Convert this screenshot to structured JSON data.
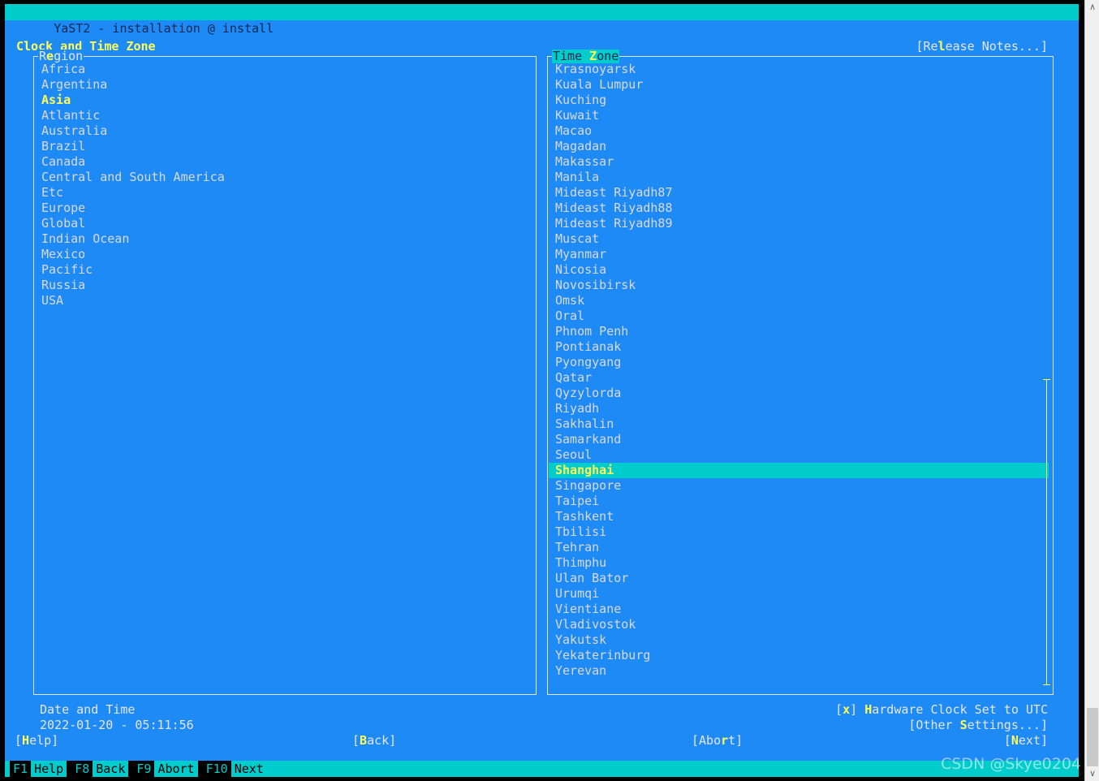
{
  "window": {
    "title": "YaST2 - installation @ install"
  },
  "header": {
    "dialog_title": "Clock and Time Zone",
    "release_notes": "[Release Notes...]",
    "release_notes_pre": "[Re",
    "release_notes_accel": "l",
    "release_notes_post": "ease Notes...]"
  },
  "region_panel": {
    "label_pre": "R",
    "label_accel": "e",
    "label_post": "gion",
    "label": "Region",
    "items": [
      "Africa",
      "Argentina",
      "Asia",
      "Atlantic",
      "Australia",
      "Brazil",
      "Canada",
      "Central and South America",
      "Etc",
      "Europe",
      "Global",
      "Indian Ocean",
      "Mexico",
      "Pacific",
      "Russia",
      "USA"
    ],
    "selected": "Asia"
  },
  "timezone_panel": {
    "label_pre": "Time ",
    "label_accel": "Z",
    "label_post": "one",
    "label": "Time Zone",
    "items": [
      "Krasnoyarsk",
      "Kuala Lumpur",
      "Kuching",
      "Kuwait",
      "Macao",
      "Magadan",
      "Makassar",
      "Manila",
      "Mideast Riyadh87",
      "Mideast Riyadh88",
      "Mideast Riyadh89",
      "Muscat",
      "Myanmar",
      "Nicosia",
      "Novosibirsk",
      "Omsk",
      "Oral",
      "Phnom Penh",
      "Pontianak",
      "Pyongyang",
      "Qatar",
      "Qyzylorda",
      "Riyadh",
      "Sakhalin",
      "Samarkand",
      "Seoul",
      "Shanghai",
      "Singapore",
      "Taipei",
      "Tashkent",
      "Tbilisi",
      "Tehran",
      "Thimphu",
      "Ulan Bator",
      "Urumqi",
      "Vientiane",
      "Vladivostok",
      "Yakutsk",
      "Yekaterinburg",
      "Yerevan"
    ],
    "selected": "Shanghai"
  },
  "datetime": {
    "label": "Date and Time",
    "value": "2022-01-20 - 05:11:56"
  },
  "hardware_clock": {
    "bracket_open": "[",
    "checked_mark": "x",
    "bracket_close": "] ",
    "accel": "H",
    "text": "ardware Clock Set to UTC",
    "full": "[x] Hardware Clock Set to UTC"
  },
  "other_settings": {
    "pre": "[Other ",
    "accel": "S",
    "post": "ettings...]",
    "full": "[Other Settings...]"
  },
  "buttons": {
    "help": {
      "pre": "[",
      "accel": "H",
      "post": "elp]",
      "full": "[Help]"
    },
    "back": {
      "pre": "[",
      "accel": "B",
      "post": "ack]",
      "full": "[Back]"
    },
    "abort": {
      "pre": "[Abo",
      "accel": "r",
      "post": "t]",
      "full": "[Abort]"
    },
    "next": {
      "pre": "[",
      "accel": "N",
      "post": "ext]",
      "full": "[Next]"
    }
  },
  "function_keys": [
    {
      "key": "F1",
      "label": "Help"
    },
    {
      "key": "F8",
      "label": "Back"
    },
    {
      "key": "F9",
      "label": "Abort"
    },
    {
      "key": "F10",
      "label": "Next"
    }
  ],
  "watermark": "CSDN @Skye0204",
  "colors": {
    "background": "#1E8AF5",
    "accent_teal": "#00CCCC",
    "accel_yellow": "#FFFF55",
    "text": "#E6E6E6",
    "frame": "#E6E6E6",
    "scrollbar_yellow": "#FFFF55"
  },
  "scrollbar_icons": {
    "up": "∧",
    "down": "∨"
  }
}
